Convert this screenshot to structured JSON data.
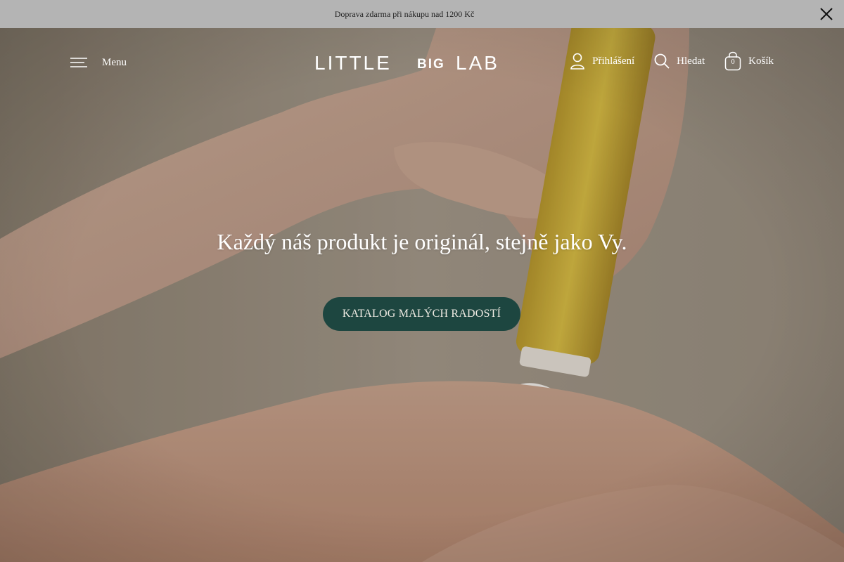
{
  "announcement": {
    "text": "Doprava zdarma při nákupu nad 1200 Kč",
    "close_icon": "close-icon"
  },
  "header": {
    "menu_label": "Menu",
    "logo": {
      "word1": "LITTLE",
      "word2": "BIG",
      "word3": "LAB"
    },
    "login_label": "Přihlášení",
    "search_label": "Hledat",
    "cart_label": "Košík",
    "cart_count": "0",
    "icons": [
      "menu-icon",
      "user-icon",
      "search-icon",
      "cart-icon"
    ]
  },
  "hero": {
    "title": "Každý náš produkt je originál, stejně jako Vy.",
    "cta_label": "KATALOG MALÝCH RADOSTÍ"
  },
  "colors": {
    "announcement_bg": "#b4b4b4",
    "cta_bg": "#1d4640",
    "tube_yellow": "#d1b53c",
    "text_on_hero": "#ffffff"
  }
}
